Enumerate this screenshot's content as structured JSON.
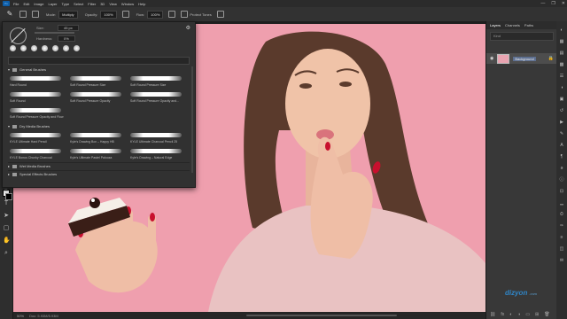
{
  "menu": {
    "app_logo": "Ps",
    "items": [
      "File",
      "Edit",
      "Image",
      "Layer",
      "Type",
      "Select",
      "Filter",
      "3D",
      "View",
      "Window",
      "Help"
    ],
    "window_controls": [
      "—",
      "❐",
      "✕"
    ]
  },
  "options": {
    "tool_icon": "brush-icon",
    "mode_label": "Mode:",
    "mode_value": "Multiply",
    "opacity_label": "Opacity:",
    "opacity_value": "100%",
    "flow_label": "Flow:",
    "flow_value": "100%",
    "protect_tones_label": "Protect Tones"
  },
  "brush_panel": {
    "size_label": "Size:",
    "size_value": "45 px",
    "hardness_label": "Hardness:",
    "hardness_value": "0%",
    "groups": [
      {
        "name": "General Brushes",
        "brushes": [
          "Hard Round",
          "Soft Round Pressure Size",
          "Soft Round Pressure Size",
          "Soft Round",
          "Soft Round Pressure Opacity",
          "Soft Round Pressure Opacity and...",
          "Soft Round Pressure Opacity and Flow"
        ]
      },
      {
        "name": "Dry Media Brushes",
        "brushes": [
          "KYLE Ultimate Hard Pencil",
          "Kyle's Drawing Box – Happy HB",
          "KYLE Ultimate Charcoal Pencil 25",
          "KYLE Bonus Chunky Charcoal",
          "Kyle's Ultimate Pastel Palooza",
          "Kyle's Drawing – Natural Edge"
        ]
      },
      {
        "name": "Wet Media Brushes"
      },
      {
        "name": "Special Effects Brushes"
      }
    ]
  },
  "layers_panel": {
    "tabs": [
      "Layers",
      "Channels",
      "Paths"
    ],
    "filter_label": "Kind",
    "layers": [
      {
        "name": "Background",
        "visible": true,
        "locked": true
      }
    ]
  },
  "status": {
    "zoom": "50%",
    "doc_info": "Doc: 5.93M/5.93M"
  },
  "watermark": {
    "brand": "dizyon",
    "suffix": ".com"
  },
  "colors": {
    "canvas_bg": "#ef9fae",
    "foreground": "#ffffff",
    "background": "#000000"
  }
}
